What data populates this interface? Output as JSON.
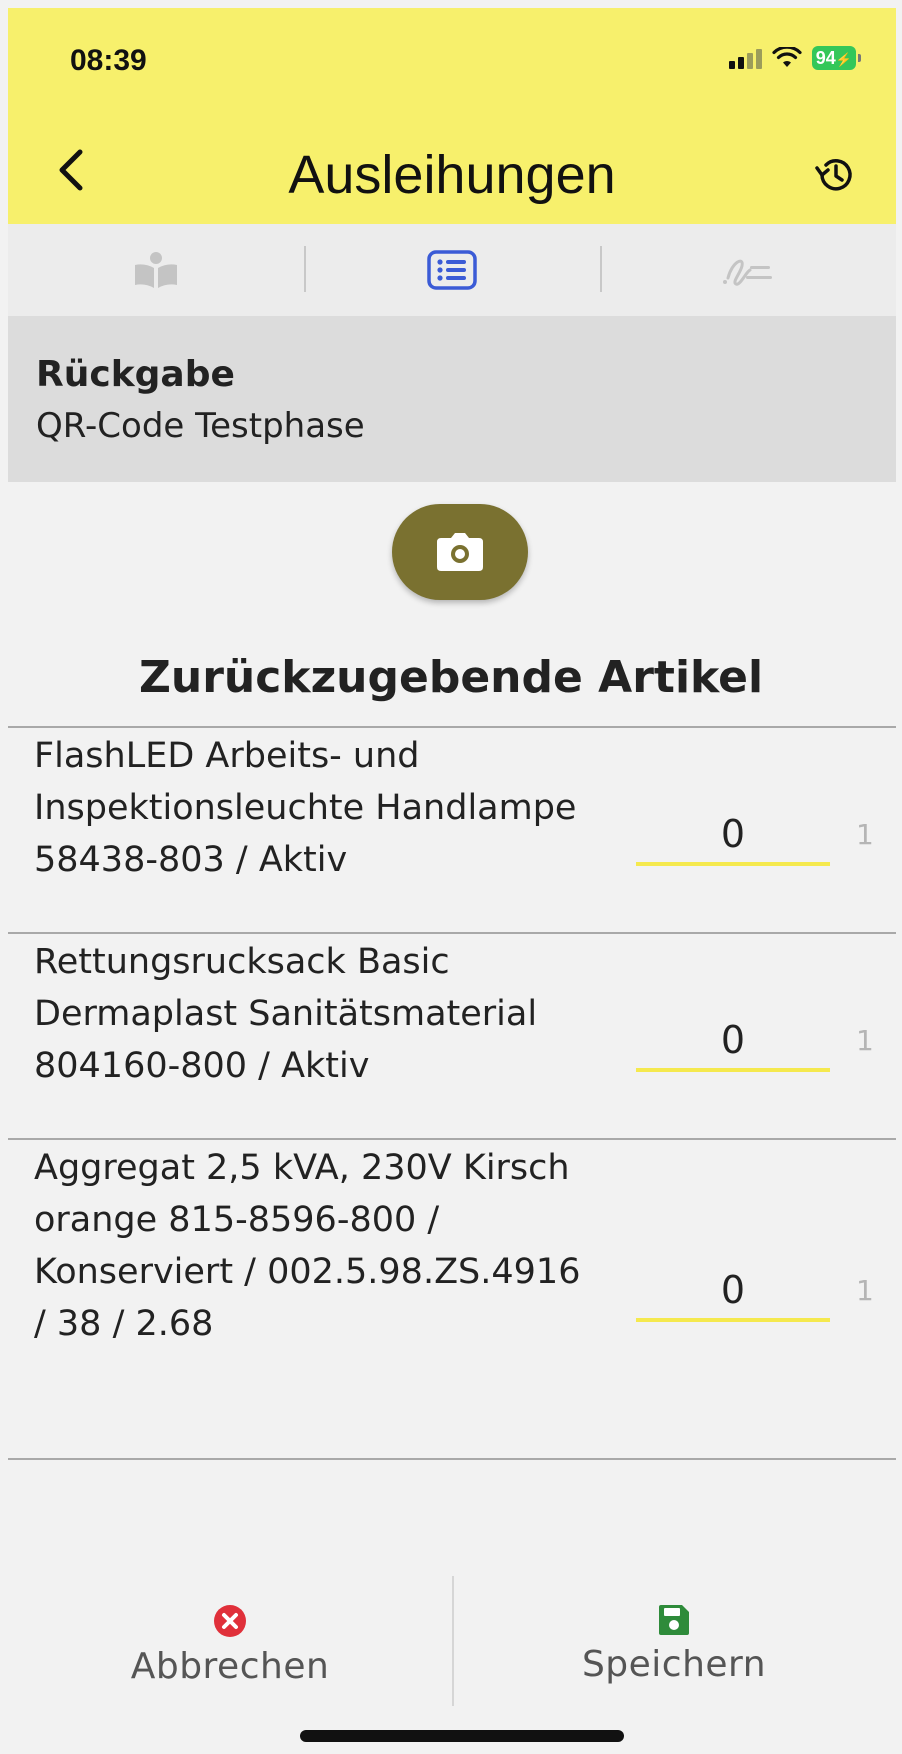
{
  "status_bar": {
    "time": "08:39",
    "battery": "94"
  },
  "header": {
    "title": "Ausleihungen",
    "background_color": "#f7f06c",
    "back_icon": "chevron-left-icon",
    "history_icon": "history-icon"
  },
  "tabs": [
    {
      "icon": "reader-icon",
      "active": false
    },
    {
      "icon": "list-icon",
      "active": true
    },
    {
      "icon": "signature-icon",
      "active": false
    }
  ],
  "info": {
    "title": "Rückgabe",
    "subtitle": "QR-Code Testphase"
  },
  "camera_button": {
    "icon": "camera-icon",
    "color": "#7a7130"
  },
  "section_title": "Zurückzugebende Artikel",
  "items": [
    {
      "description": "FlashLED Arbeits- und Inspektionsleuchte Handlampe 58438-803 / Aktiv",
      "quantity": "0",
      "max": "1"
    },
    {
      "description": "Rettungsrucksack Basic Dermaplast Sanitätsmaterial 804160-800 / Aktiv",
      "quantity": "0",
      "max": "1"
    },
    {
      "description": "Aggregat 2,5 kVA, 230V Kirsch orange 815-8596-800 / Konserviert / 002.5.98.ZS.4916 / 38 / 2.68",
      "quantity": "0",
      "max": "1"
    }
  ],
  "footer": {
    "cancel_label": "Abbrechen",
    "cancel_icon": "close-circle-icon",
    "cancel_color": "#e0303a",
    "save_label": "Speichern",
    "save_icon": "save-icon",
    "save_color": "#2e8b3a"
  }
}
